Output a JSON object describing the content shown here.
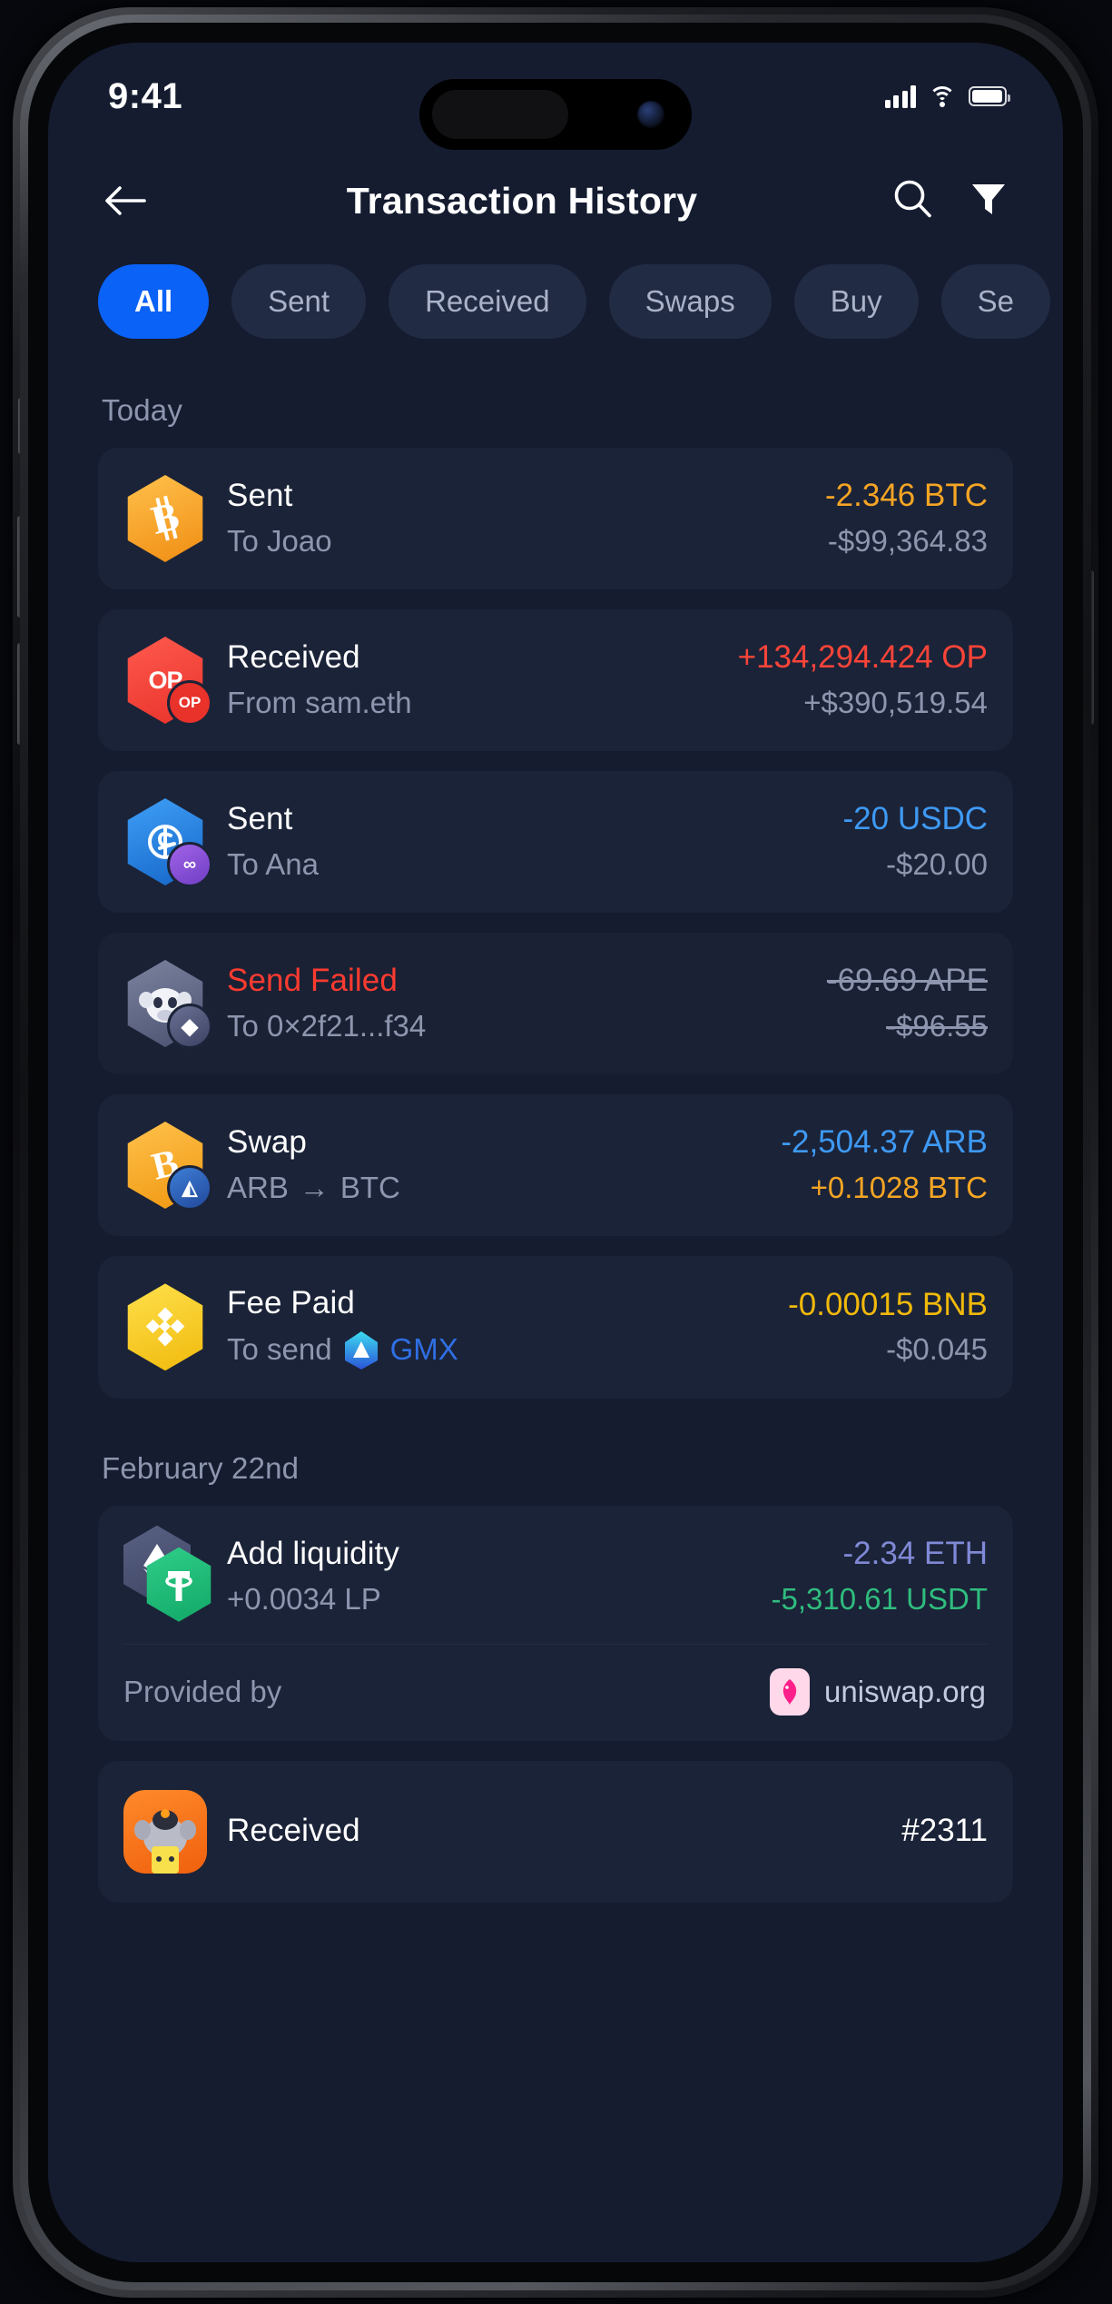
{
  "status_bar": {
    "time": "9:41",
    "signal_icon": "cellular-signal-icon",
    "wifi_icon": "wifi-icon",
    "battery_icon": "battery-full-icon"
  },
  "header": {
    "back_icon": "back-arrow-icon",
    "title": "Transaction History",
    "search_icon": "search-icon",
    "filter_icon": "filter-funnel-icon"
  },
  "filters": {
    "items": [
      {
        "label": "All",
        "active": true
      },
      {
        "label": "Sent",
        "active": false
      },
      {
        "label": "Received",
        "active": false
      },
      {
        "label": "Swaps",
        "active": false
      },
      {
        "label": "Buy",
        "active": false
      },
      {
        "label": "Se",
        "active": false
      }
    ],
    "active_color": "#0a62f7"
  },
  "sections": [
    {
      "label": "Today"
    },
    {
      "label": "February 22nd"
    }
  ],
  "transactions": [
    {
      "title": "Sent",
      "subtitle": "To Joao",
      "amount": "-2.346 BTC",
      "amount_color": "#f5a524",
      "fiat": "-$99,364.83",
      "icon": "bitcoin-token-icon"
    },
    {
      "title": "Received",
      "subtitle": "From sam.eth",
      "amount": "+134,294.424 OP",
      "amount_color": "#fc4438",
      "fiat": "+$390,519.54",
      "icon": "optimism-token-icon"
    },
    {
      "title": "Sent",
      "subtitle": "To Ana",
      "amount": "-20 USDC",
      "amount_color": "#3e9af5",
      "fiat": "-$20.00",
      "icon": "usdc-token-icon"
    },
    {
      "title": "Send Failed",
      "title_color": "#ff3b30",
      "subtitle": "To 0×2f21...f34",
      "amount": "-69.69 APE",
      "fiat": "-$96.55",
      "struck": true,
      "icon": "ape-nft-token-icon"
    },
    {
      "title": "Swap",
      "subtitle_from": "ARB",
      "subtitle_arrow": "→",
      "subtitle_to": "BTC",
      "amount": "-2,504.37 ARB",
      "amount_color": "#3e9af5",
      "fiat": "+0.1028 BTC",
      "fiat_color": "#f5a524",
      "icon": "arbitrum-bitcoin-swap-icon"
    },
    {
      "title": "Fee Paid",
      "subtitle_prefix": "To send",
      "subtitle_link": "GMX",
      "subtitle_link_color": "#2f6fe4",
      "amount": "-0.00015 BNB",
      "amount_color": "#f0b90b",
      "fiat": "-$0.045",
      "icon": "bnb-token-icon",
      "link_icon": "gmx-token-icon"
    },
    {
      "title": "Add liquidity",
      "subtitle": "+0.0034 LP",
      "amount": "-2.34 ETH",
      "amount_color": "#8089d6",
      "fiat": "-5,310.61 USDT",
      "fiat_color": "#2fbd7e",
      "icon": "eth-usdt-pair-icon",
      "provided_by_label": "Provided by",
      "provided_by_value": "uniswap.org",
      "provided_by_icon": "uniswap-icon"
    },
    {
      "title": "Received",
      "amount": "#2311",
      "amount_color": "#ffffff",
      "icon": "nft-ape-avatar-icon"
    }
  ]
}
